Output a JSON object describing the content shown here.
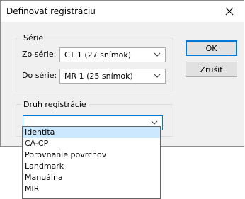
{
  "window": {
    "title": "Definovať registráciu"
  },
  "series": {
    "group_label": "Série",
    "from_label": "Zo série:",
    "from_value": "CT 1 (27 snímok)",
    "to_label": "Do série:",
    "to_value": "MR 1 (25 snímok)"
  },
  "registration": {
    "group_label": "Druh registrácie",
    "value": "",
    "options": [
      "Identita",
      "CA-CP",
      "Porovnanie povrchov",
      "Landmark",
      "Manuálna",
      "MIR"
    ],
    "highlighted_index": 0
  },
  "buttons": {
    "ok": "OK",
    "cancel": "Zrušiť"
  },
  "icons": {
    "close": "close-icon",
    "dropdown": "chevron-down-icon"
  },
  "colors": {
    "accent": "#0078d7",
    "highlight": "#cce8ff",
    "dialog_bg": "#f0f0f0"
  }
}
